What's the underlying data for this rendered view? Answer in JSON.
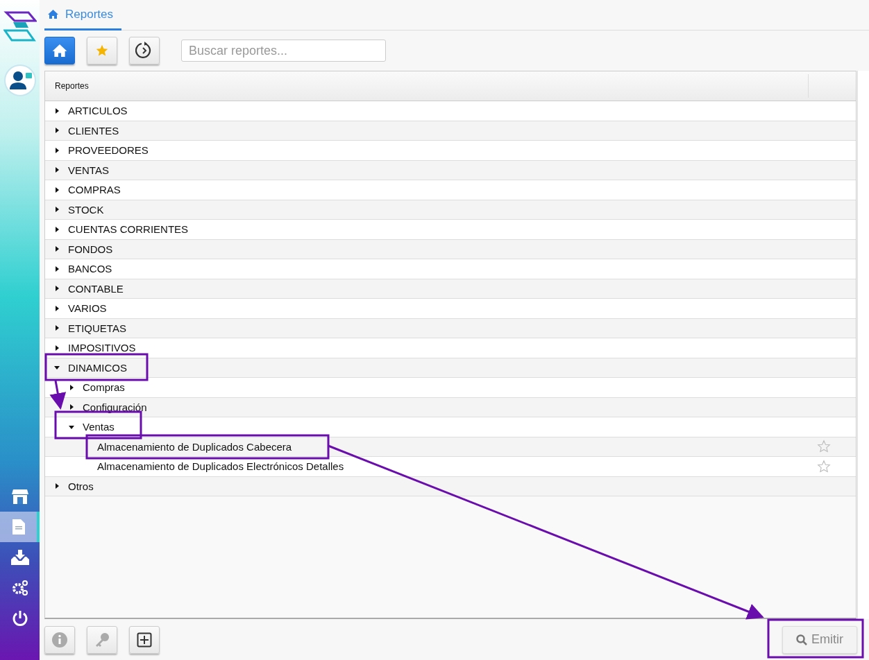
{
  "tab": {
    "label": "Reportes",
    "selected": true
  },
  "search": {
    "placeholder": "Buscar reportes..."
  },
  "table": {
    "column_1": "Reportes"
  },
  "tree": [
    {
      "label": "ARTICULOS",
      "expanded": false
    },
    {
      "label": "CLIENTES",
      "expanded": false
    },
    {
      "label": "PROVEEDORES",
      "expanded": false
    },
    {
      "label": "VENTAS",
      "expanded": false
    },
    {
      "label": "COMPRAS",
      "expanded": false
    },
    {
      "label": "STOCK",
      "expanded": false
    },
    {
      "label": "CUENTAS CORRIENTES",
      "expanded": false
    },
    {
      "label": "FONDOS",
      "expanded": false
    },
    {
      "label": "BANCOS",
      "expanded": false
    },
    {
      "label": "CONTABLE",
      "expanded": false
    },
    {
      "label": "VARIOS",
      "expanded": false
    },
    {
      "label": "ETIQUETAS",
      "expanded": false
    },
    {
      "label": "IMPOSITIVOS",
      "expanded": false
    },
    {
      "label": "DINAMICOS",
      "expanded": true,
      "children": [
        {
          "label": "Compras",
          "expanded": false
        },
        {
          "label": "Configuración",
          "expanded": false
        },
        {
          "label": "Ventas",
          "expanded": true,
          "children": [
            {
              "label": "Almacenamiento de Duplicados Cabecera",
              "kind": "report",
              "favorite": false
            },
            {
              "label": "Almacenamiento de Duplicados Electrónicos Detalles",
              "kind": "report",
              "favorite": false
            }
          ]
        }
      ]
    },
    {
      "label": "Otros",
      "expanded": false
    }
  ],
  "emit_button": {
    "label": "Emitir",
    "disabled": true
  }
}
